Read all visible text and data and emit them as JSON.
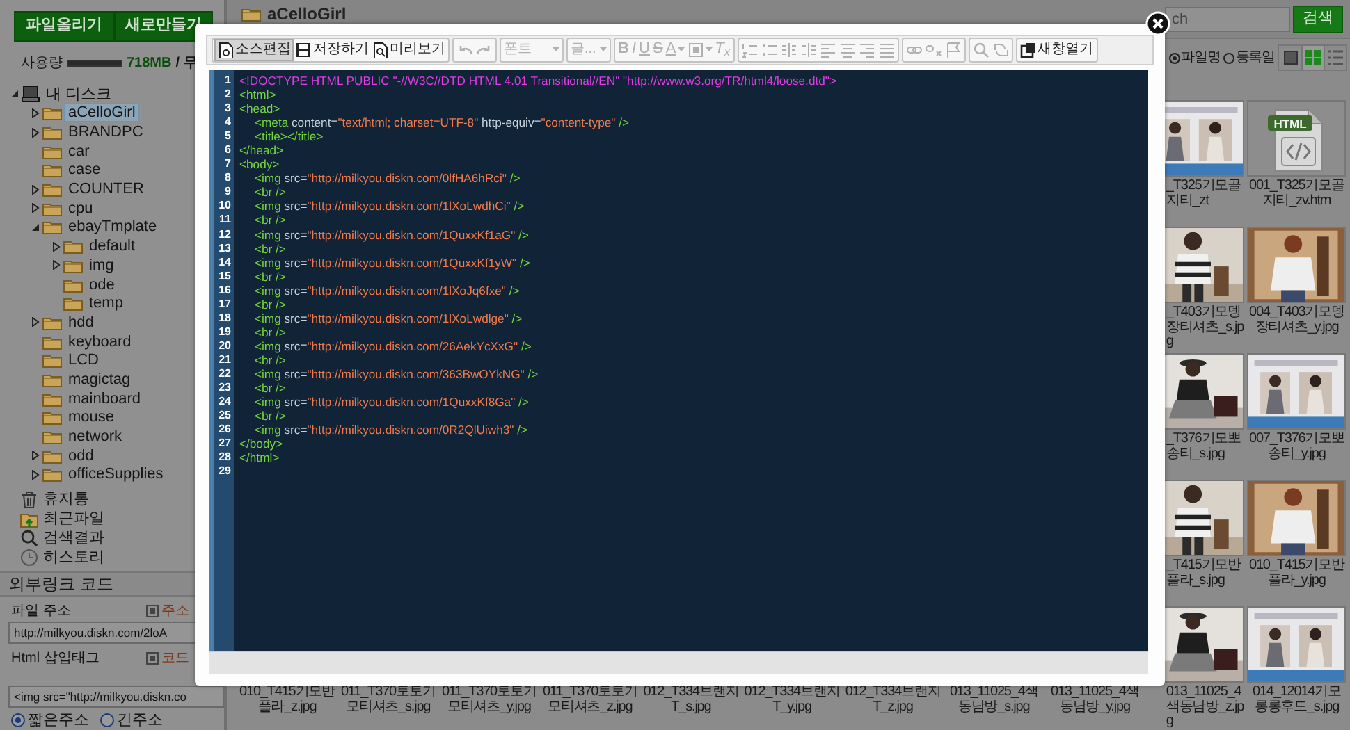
{
  "sidebar": {
    "buttons": [
      "파일올리기",
      "새로만들기"
    ],
    "usage": {
      "label": "사용량",
      "level": 1,
      "used": "718MB",
      "quota": "/ 무"
    },
    "tree": [
      {
        "label": "내 디스크",
        "kind": "disk",
        "expandable": true,
        "expanded": true,
        "selected": false,
        "children": [
          {
            "label": "aCelloGirl",
            "kind": "folder",
            "expandable": true,
            "expanded": false,
            "selected": true
          },
          {
            "label": "BRANDPC",
            "kind": "folder",
            "expandable": true,
            "expanded": false,
            "selected": false
          },
          {
            "label": "car",
            "kind": "folder",
            "expandable": false,
            "expanded": false,
            "selected": false
          },
          {
            "label": "case",
            "kind": "folder",
            "expandable": false,
            "expanded": false,
            "selected": false
          },
          {
            "label": "COUNTER",
            "kind": "folder",
            "expandable": true,
            "expanded": false,
            "selected": false
          },
          {
            "label": "cpu",
            "kind": "folder",
            "expandable": true,
            "expanded": false,
            "selected": false
          },
          {
            "label": "ebayTmplate",
            "kind": "folder",
            "expandable": true,
            "expanded": true,
            "selected": false,
            "children": [
              {
                "label": "default",
                "kind": "folder",
                "expandable": true,
                "expanded": false,
                "selected": false
              },
              {
                "label": "img",
                "kind": "folder",
                "expandable": true,
                "expanded": false,
                "selected": false
              },
              {
                "label": "ode",
                "kind": "folder",
                "expandable": false,
                "expanded": false,
                "selected": false
              },
              {
                "label": "temp",
                "kind": "folder",
                "expandable": false,
                "expanded": false,
                "selected": false
              }
            ]
          },
          {
            "label": "hdd",
            "kind": "folder",
            "expandable": true,
            "expanded": false,
            "selected": false
          },
          {
            "label": "keyboard",
            "kind": "folder",
            "expandable": false,
            "expanded": false,
            "selected": false
          },
          {
            "label": "LCD",
            "kind": "folder",
            "expandable": false,
            "expanded": false,
            "selected": false
          },
          {
            "label": "magictag",
            "kind": "folder",
            "expandable": false,
            "expanded": false,
            "selected": false
          },
          {
            "label": "mainboard",
            "kind": "folder",
            "expandable": false,
            "expanded": false,
            "selected": false
          },
          {
            "label": "mouse",
            "kind": "folder",
            "expandable": false,
            "expanded": false,
            "selected": false
          },
          {
            "label": "network",
            "kind": "folder",
            "expandable": false,
            "expanded": false,
            "selected": false
          },
          {
            "label": "odd",
            "kind": "folder",
            "expandable": true,
            "expanded": false,
            "selected": false
          },
          {
            "label": "officeSupplies",
            "kind": "folder",
            "expandable": true,
            "expanded": false,
            "selected": false
          }
        ]
      }
    ],
    "shortcuts": [
      {
        "label": "휴지통",
        "kind": "trash"
      },
      {
        "label": "최근파일",
        "kind": "recent"
      },
      {
        "label": "검색결과",
        "kind": "search"
      },
      {
        "label": "히스토리",
        "kind": "history"
      }
    ],
    "external_link": {
      "title": "외부링크 코드",
      "fields": [
        {
          "label": "파일 주소",
          "action": "주소",
          "value": "http://milkyou.diskn.com/2loA"
        },
        {
          "label": "Html 삽입태그",
          "action": "코드",
          "value": "<img src=\"http://milkyou.diskn.co"
        }
      ],
      "address_options": [
        {
          "label": "짧은주소",
          "selected": true
        },
        {
          "label": "긴주소",
          "selected": false
        }
      ]
    }
  },
  "main": {
    "folder_title": "aCelloGirl",
    "search": {
      "placeholder": "ch",
      "button": "검색"
    },
    "sort_options": [
      {
        "label": "파일명",
        "selected": true
      },
      {
        "label": "등록일",
        "selected": false
      }
    ],
    "view_modes": [
      {
        "kind": "large",
        "selected": false
      },
      {
        "kind": "grid",
        "selected": true
      },
      {
        "kind": "list",
        "selected": false
      }
    ],
    "file_grid": {
      "rows": [
        {
          "items": [
            {
              "label": "_T325기모골지티_zt",
              "kind": "picture"
            },
            {
              "label": "001_T325기모골지티_zv.htm",
              "kind": "html-file",
              "icon_text": "HTML"
            }
          ]
        },
        {
          "items": [
            {
              "label": "_T403기모뎅장티셔츠_s.jpg",
              "kind": "picture"
            },
            {
              "label": "004_T403기모뎅장티셔츠_y.jpg",
              "kind": "picture"
            }
          ]
        },
        {
          "items": [
            {
              "label": "_T376기모뽀송티_s.jpg",
              "kind": "picture"
            },
            {
              "label": "007_T376기모뽀송티_y.jpg",
              "kind": "picture"
            }
          ]
        },
        {
          "items": [
            {
              "label": "_T415기모반플라_s.jpg",
              "kind": "picture"
            },
            {
              "label": "010_T415기모반플라_y.jpg",
              "kind": "picture"
            }
          ]
        },
        {
          "items": [
            {
              "label": "010_T415기모반플라_z.jpg"
            },
            {
              "label": "011_T370토토기모티셔츠_s.jpg"
            },
            {
              "label": "011_T370토토기모티셔츠_y.jpg"
            },
            {
              "label": "011_T370토토기모티셔츠_z.jpg"
            },
            {
              "label": "012_T334브랜지T_s.jpg"
            },
            {
              "label": "012_T334브랜지T_y.jpg"
            },
            {
              "label": "012_T334브랜지T_z.jpg"
            },
            {
              "label": "013_11025_4색동남방_s.jpg"
            },
            {
              "label": "013_11025_4색동남방_y.jpg"
            },
            {
              "label": "013_11025_4색동남방_z.jpg",
              "kind": "picture"
            },
            {
              "label": "014_12014기모롱롱후드_s.jpg",
              "kind": "picture"
            }
          ]
        }
      ]
    }
  },
  "editor": {
    "toolbar": [
      {
        "items": [
          {
            "kind": "labeled",
            "label": "소스편집",
            "selected": true,
            "disabled": false
          },
          {
            "kind": "labeled",
            "label": "저장하기",
            "selected": false,
            "disabled": false
          },
          {
            "kind": "labeled",
            "label": "미리보기",
            "selected": false,
            "disabled": false
          }
        ]
      },
      {
        "items": [
          {
            "kind": "icon",
            "disabled": true
          },
          {
            "kind": "icon",
            "disabled": true
          }
        ]
      },
      {
        "items": [
          {
            "kind": "dropdown",
            "label": "폰트",
            "disabled": true
          }
        ]
      },
      {
        "items": [
          {
            "kind": "dropdown",
            "label": "글...",
            "disabled": true
          }
        ]
      },
      {
        "items": [
          {
            "kind": "glyph",
            "label": "B",
            "disabled": true
          },
          {
            "kind": "glyph",
            "label": "I",
            "disabled": true
          },
          {
            "kind": "glyph",
            "label": "U",
            "disabled": true
          },
          {
            "kind": "glyph",
            "label": "S",
            "disabled": true
          },
          {
            "kind": "glyph-menu",
            "label": "A",
            "disabled": true
          },
          {
            "kind": "icon-menu",
            "disabled": true
          },
          {
            "kind": "glyph",
            "label": "T$_{x}$",
            "disabled": true
          }
        ]
      },
      {
        "items": [
          {
            "kind": "icon",
            "disabled": true
          },
          {
            "kind": "icon",
            "disabled": true
          },
          {
            "kind": "icon",
            "disabled": true
          },
          {
            "kind": "icon",
            "disabled": true
          },
          {
            "kind": "icon",
            "disabled": true
          },
          {
            "kind": "icon",
            "disabled": true
          },
          {
            "kind": "icon",
            "disabled": true
          },
          {
            "kind": "icon",
            "disabled": true
          }
        ]
      },
      {
        "items": [
          {
            "kind": "icon",
            "disabled": true
          },
          {
            "kind": "icon",
            "disabled": true
          },
          {
            "kind": "icon",
            "disabled": true
          }
        ]
      },
      {
        "items": [
          {
            "kind": "icon",
            "disabled": true
          },
          {
            "kind": "icon",
            "disabled": true
          }
        ]
      },
      {
        "items": [
          {
            "kind": "labeled",
            "label": "새창열기",
            "selected": false,
            "disabled": false
          }
        ]
      }
    ],
    "lines": [
      {
        "number": "1",
        "indent": false,
        "tokens": [
          {
            "kind": "doctype",
            "text": "<!DOCTYPE HTML PUBLIC \"-//W3C//DTD HTML 4.01 Transitional//EN\" \"http://www.w3.org/TR/html4/loose.dtd\">"
          }
        ]
      },
      {
        "number": "2",
        "indent": false,
        "tokens": [
          {
            "kind": "tag",
            "text": "<html>"
          }
        ]
      },
      {
        "number": "3",
        "indent": false,
        "tokens": [
          {
            "kind": "tag",
            "text": "<head>"
          }
        ]
      },
      {
        "number": "4",
        "indent": true,
        "tokens": [
          {
            "kind": "tag",
            "text": "<meta"
          },
          {
            "kind": "attr",
            "text": " content="
          },
          {
            "kind": "value",
            "text": "\"text/html; charset=UTF-8\""
          },
          {
            "kind": "attr",
            "text": " http-equiv="
          },
          {
            "kind": "value",
            "text": "\"content-type\""
          },
          {
            "kind": "tag",
            "text": " />"
          }
        ]
      },
      {
        "number": "5",
        "indent": true,
        "tokens": [
          {
            "kind": "tag",
            "text": "<title></title>"
          }
        ]
      },
      {
        "number": "6",
        "indent": false,
        "tokens": [
          {
            "kind": "tag",
            "text": "</head>"
          }
        ]
      },
      {
        "number": "7",
        "indent": false,
        "tokens": [
          {
            "kind": "tag",
            "text": "<body>"
          }
        ]
      },
      {
        "number": "8",
        "indent": true,
        "tokens": [
          {
            "kind": "tag",
            "text": "<img"
          },
          {
            "kind": "attr",
            "text": " src="
          },
          {
            "kind": "value",
            "text": "\"http://milkyou.diskn.com/0lfHA6hRci\""
          },
          {
            "kind": "tag",
            "text": " />"
          }
        ]
      },
      {
        "number": "9",
        "indent": true,
        "tokens": [
          {
            "kind": "tag",
            "text": "<br />"
          }
        ]
      },
      {
        "number": "10",
        "indent": true,
        "tokens": [
          {
            "kind": "tag",
            "text": "<img"
          },
          {
            "kind": "attr",
            "text": " src="
          },
          {
            "kind": "value",
            "text": "\"http://milkyou.diskn.com/1lXoLwdhCi\""
          },
          {
            "kind": "tag",
            "text": " />"
          }
        ]
      },
      {
        "number": "11",
        "indent": true,
        "tokens": [
          {
            "kind": "tag",
            "text": "<br />"
          }
        ]
      },
      {
        "number": "12",
        "indent": true,
        "tokens": [
          {
            "kind": "tag",
            "text": "<img"
          },
          {
            "kind": "attr",
            "text": " src="
          },
          {
            "kind": "value",
            "text": "\"http://milkyou.diskn.com/1QuxxKf1aG\""
          },
          {
            "kind": "tag",
            "text": " />"
          }
        ]
      },
      {
        "number": "13",
        "indent": true,
        "tokens": [
          {
            "kind": "tag",
            "text": "<br />"
          }
        ]
      },
      {
        "number": "14",
        "indent": true,
        "tokens": [
          {
            "kind": "tag",
            "text": "<img"
          },
          {
            "kind": "attr",
            "text": " src="
          },
          {
            "kind": "value",
            "text": "\"http://milkyou.diskn.com/1QuxxKf1yW\""
          },
          {
            "kind": "tag",
            "text": " />"
          }
        ]
      },
      {
        "number": "15",
        "indent": true,
        "tokens": [
          {
            "kind": "tag",
            "text": "<br />"
          }
        ]
      },
      {
        "number": "16",
        "indent": true,
        "tokens": [
          {
            "kind": "tag",
            "text": "<img"
          },
          {
            "kind": "attr",
            "text": " src="
          },
          {
            "kind": "value",
            "text": "\"http://milkyou.diskn.com/1lXoJq6fxe\""
          },
          {
            "kind": "tag",
            "text": " />"
          }
        ]
      },
      {
        "number": "17",
        "indent": true,
        "tokens": [
          {
            "kind": "tag",
            "text": "<br />"
          }
        ]
      },
      {
        "number": "18",
        "indent": true,
        "tokens": [
          {
            "kind": "tag",
            "text": "<img"
          },
          {
            "kind": "attr",
            "text": " src="
          },
          {
            "kind": "value",
            "text": "\"http://milkyou.diskn.com/1lXoLwdlge\""
          },
          {
            "kind": "tag",
            "text": " />"
          }
        ]
      },
      {
        "number": "19",
        "indent": true,
        "tokens": [
          {
            "kind": "tag",
            "text": "<br />"
          }
        ]
      },
      {
        "number": "20",
        "indent": true,
        "tokens": [
          {
            "kind": "tag",
            "text": "<img"
          },
          {
            "kind": "attr",
            "text": " src="
          },
          {
            "kind": "value",
            "text": "\"http://milkyou.diskn.com/26AekYcXxG\""
          },
          {
            "kind": "tag",
            "text": " />"
          }
        ]
      },
      {
        "number": "21",
        "indent": true,
        "tokens": [
          {
            "kind": "tag",
            "text": "<br />"
          }
        ]
      },
      {
        "number": "22",
        "indent": true,
        "tokens": [
          {
            "kind": "tag",
            "text": "<img"
          },
          {
            "kind": "attr",
            "text": " src="
          },
          {
            "kind": "value",
            "text": "\"http://milkyou.diskn.com/363BwOYkNG\""
          },
          {
            "kind": "tag",
            "text": " />"
          }
        ]
      },
      {
        "number": "23",
        "indent": true,
        "tokens": [
          {
            "kind": "tag",
            "text": "<br />"
          }
        ]
      },
      {
        "number": "24",
        "indent": true,
        "tokens": [
          {
            "kind": "tag",
            "text": "<img"
          },
          {
            "kind": "attr",
            "text": " src="
          },
          {
            "kind": "value",
            "text": "\"http://milkyou.diskn.com/1QuxxKf8Ga\""
          },
          {
            "kind": "tag",
            "text": " />"
          }
        ]
      },
      {
        "number": "25",
        "indent": true,
        "tokens": [
          {
            "kind": "tag",
            "text": "<br />"
          }
        ]
      },
      {
        "number": "26",
        "indent": true,
        "tokens": [
          {
            "kind": "tag",
            "text": "<img"
          },
          {
            "kind": "attr",
            "text": " src="
          },
          {
            "kind": "value",
            "text": "\"http://milkyou.diskn.com/0R2QlUiwh3\""
          },
          {
            "kind": "tag",
            "text": " />"
          }
        ]
      },
      {
        "number": "27",
        "indent": false,
        "tokens": [
          {
            "kind": "tag",
            "text": "</body>"
          }
        ]
      },
      {
        "number": "28",
        "indent": false,
        "tokens": [
          {
            "kind": "tag",
            "text": "</html>"
          }
        ]
      },
      {
        "number": "29"
      }
    ]
  }
}
